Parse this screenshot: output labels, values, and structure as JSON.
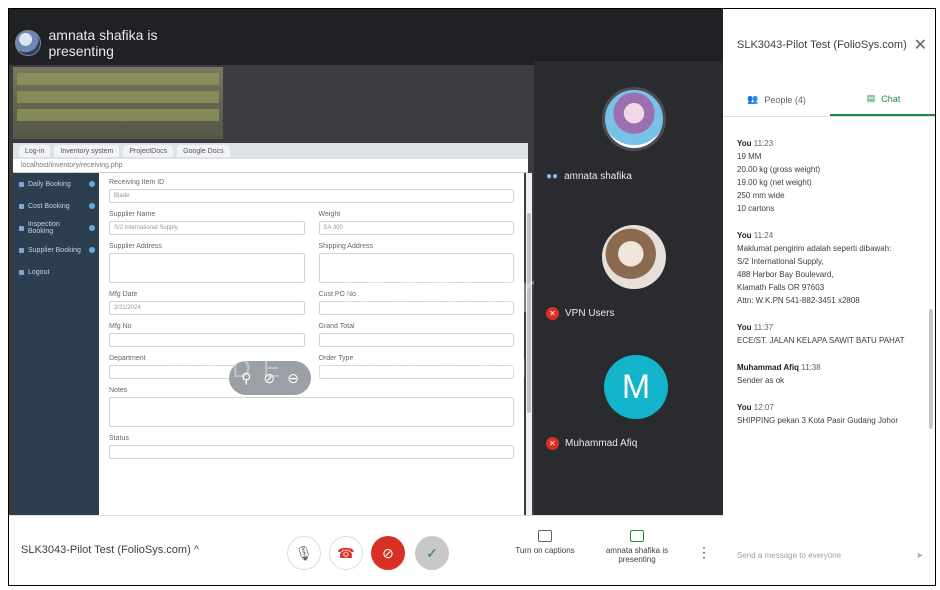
{
  "presenter": {
    "label": "amnata shafika is presenting"
  },
  "shared_screen": {
    "browser_tabs": [
      "Log-in",
      "Inventory system",
      "ProjectDocs",
      "Google Docs"
    ],
    "url": "localhost/inventory/receiving.php",
    "sidebar_items": [
      "Daily Booking",
      "Cost Booking",
      "Inspection Booking",
      "Supplier Booking",
      "Logout"
    ],
    "form": {
      "fields_left": [
        "Receiving Item ID",
        "Supplier Name",
        "Supplier Address",
        "Mfg Date",
        "Mfg No",
        "Department",
        "Notes",
        "Status"
      ],
      "fields_right": [
        "Weight",
        "Shipping Address",
        "Cust PO No",
        "Grand Total",
        "Order Type"
      ],
      "values": [
        "Blade",
        "S/2 International Supply",
        "SA 300",
        "3/31/2024"
      ]
    }
  },
  "watermark": {
    "brand": "TechSmith",
    "trial": "MADE WITH CAMTASIA FREE TRIAL"
  },
  "participants": [
    {
      "name": "amnata shafika",
      "mic": "on"
    },
    {
      "name": "VPN Users",
      "mic": "off"
    },
    {
      "name": "Muhammad Afiq",
      "mic": "off",
      "initial": "M"
    }
  ],
  "chat": {
    "header": "SLK3043-Pilot Test (FolioSys.com)",
    "tabs": {
      "people": "People (4)",
      "chat": "Chat"
    },
    "messages": [
      {
        "sender": "You",
        "time": "11:23",
        "lines": [
          "19 MM",
          "20.00 kg (gross weight)",
          "19.00 kg (net weight)",
          "250 mm wide",
          "10 cartons"
        ]
      },
      {
        "sender": "You",
        "time": "11:24",
        "lines": [
          "Maklumat pengirim adalah seperti dibawah:",
          "S/2 International Supply,",
          "488 Harbor Bay Boulevard,",
          "Klamath Falls OR 97603",
          "Attn: W.K.PN 541-882-3451 x2808"
        ]
      },
      {
        "sender": "You",
        "time": "11:37",
        "lines": [
          "ECE/ST. JALAN KELAPA SAWIT BATU PAHAT"
        ]
      },
      {
        "sender": "Muhammad Afiq",
        "time": "11:38",
        "lines": [
          "Sender as ok"
        ]
      },
      {
        "sender": "You",
        "time": "12:07",
        "lines": [
          "SHIPPING pekan 3 Kota Pasir Gudang Johor"
        ]
      }
    ],
    "input_placeholder": "Send a message to everyone"
  },
  "bottom_bar": {
    "meeting_title": "SLK3043-Pilot Test (FolioSys.com)",
    "captions_label": "Turn on captions",
    "present_label": "amnata shafika is presenting"
  },
  "colors": {
    "meet_dark": "#202124",
    "accent_green": "#1e8e3e",
    "hangup_red": "#d93025",
    "avatar_teal": "#12b5cb"
  }
}
